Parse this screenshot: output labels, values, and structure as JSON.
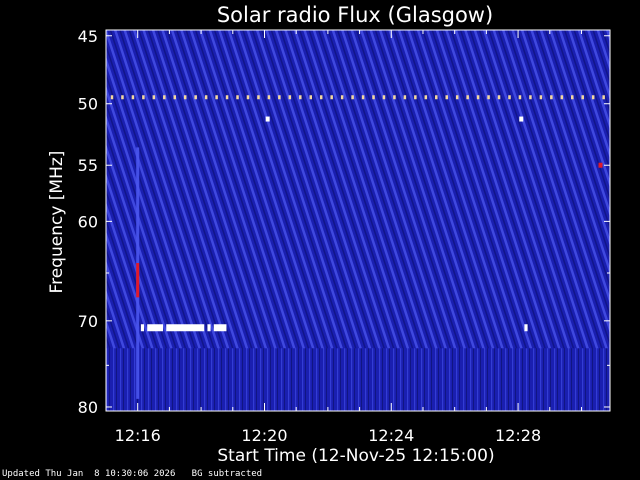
{
  "chart_data": {
    "type": "heatmap",
    "title": "Solar radio Flux (Glasgow)",
    "xlabel": "Start Time (12-Nov-25 12:15:00)",
    "ylabel": "Frequency [MHz]",
    "x_range_minutes": [
      0,
      15.9
    ],
    "y_range_mhz": [
      44.6,
      80.5
    ],
    "y_scale": "log",
    "x_ticks": [
      {
        "label": "12:16",
        "minute": 1
      },
      {
        "label": "12:20",
        "minute": 5
      },
      {
        "label": "12:24",
        "minute": 9
      },
      {
        "label": "12:28",
        "minute": 13
      }
    ],
    "y_ticks": [
      45,
      50,
      55,
      60,
      70,
      80
    ],
    "y_minor_ticks": [
      65,
      75
    ],
    "colors": {
      "background": "#1a1fb0",
      "stripe": "#4a55ee",
      "dark_stripe": "#0f1380",
      "hot": "#e0192a",
      "white": "#ffffff",
      "plot_frame": "#ffffff"
    },
    "features": {
      "interference_line_mhz": 49.5,
      "bright_marks": [
        {
          "minute": 5.1,
          "mhz": 51.2
        },
        {
          "minute": 13.1,
          "mhz": 51.2
        },
        {
          "minute": 15.6,
          "mhz": 55.0
        }
      ],
      "burst_band_mhz": 70.7,
      "burst_segments_minutes": [
        [
          1.1,
          1.2
        ],
        [
          1.3,
          1.8
        ],
        [
          1.9,
          3.1
        ],
        [
          3.2,
          3.3
        ],
        [
          3.4,
          3.8
        ],
        [
          13.2,
          13.3
        ]
      ],
      "vertical_burst_minute": 1.0,
      "vertical_burst_mhz": [
        53.5,
        79
      ]
    }
  },
  "footer": {
    "updated": "Updated Thu Jan  8 10:30:06 2026",
    "bg_note": "BG subtracted"
  }
}
